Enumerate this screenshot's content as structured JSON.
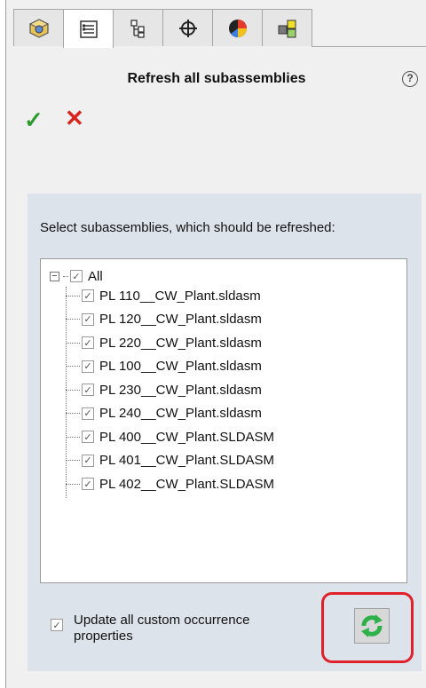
{
  "panel": {
    "tabs": [
      {
        "icon": "part-icon",
        "active": false
      },
      {
        "icon": "property-manager-icon",
        "active": true
      },
      {
        "icon": "config-manager-icon",
        "active": false
      },
      {
        "icon": "dimxpert-icon",
        "active": false
      },
      {
        "icon": "display-manager-icon",
        "active": false
      },
      {
        "icon": "plugin-icon",
        "active": false
      }
    ],
    "title": "Refresh all subassemblies",
    "help_glyph": "?",
    "ok_glyph": "✓",
    "cancel_glyph": "✕"
  },
  "group": {
    "instruction": "Select subassemblies, which should be refreshed:",
    "root": {
      "label": "All",
      "checked": true,
      "expander": "−"
    },
    "items": [
      {
        "label": "PL 110__CW_Plant.sldasm",
        "checked": true
      },
      {
        "label": "PL 120__CW_Plant.sldasm",
        "checked": true
      },
      {
        "label": "PL 220__CW_Plant.sldasm",
        "checked": true
      },
      {
        "label": "PL 100__CW_Plant.sldasm",
        "checked": true
      },
      {
        "label": "PL 230__CW_Plant.sldasm",
        "checked": true
      },
      {
        "label": "PL 240__CW_Plant.sldasm",
        "checked": true
      },
      {
        "label": "PL 400__CW_Plant.SLDASM",
        "checked": true
      },
      {
        "label": "PL 401__CW_Plant.SLDASM",
        "checked": true
      },
      {
        "label": "PL 402__CW_Plant.SLDASM",
        "checked": true
      }
    ],
    "update_option": {
      "label": "Update all custom occurrence properties",
      "checked": true
    },
    "refresh_button": {
      "icon": "refresh-icon"
    }
  },
  "colors": {
    "accent_ok": "#2e9b2e",
    "accent_cancel": "#d9241d",
    "highlight": "#e0202a"
  }
}
